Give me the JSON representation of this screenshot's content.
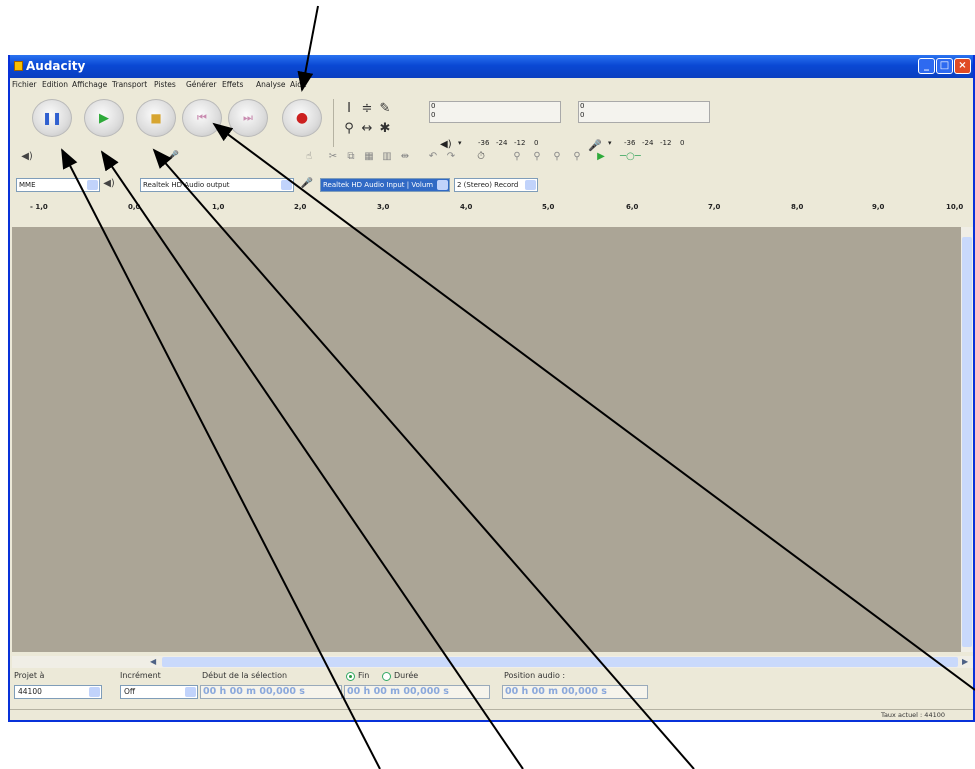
{
  "window": {
    "title": "Audacity"
  },
  "menubar": {
    "items": [
      "Fichier",
      "Edition",
      "Affichage",
      "Transport",
      "Pistes",
      "Générer",
      "Effets",
      "Analyse",
      "Aide"
    ]
  },
  "meters": {
    "play_zero": "0",
    "rec_zero": "0",
    "scale": [
      "-36",
      "-24",
      "-12",
      "0"
    ]
  },
  "devices": {
    "host": "MME",
    "output": "Realtek HD Audio output",
    "input": "Realtek HD Audio Input | Volum",
    "channels": "2 (Stereo) Record"
  },
  "ruler": {
    "ticks": [
      "- 1,0",
      "0,0",
      "1,0",
      "2,0",
      "3,0",
      "4,0",
      "5,0",
      "6,0",
      "7,0",
      "8,0",
      "9,0",
      "10,0"
    ]
  },
  "selection": {
    "rate_label": "Projet à",
    "rate_value": "44100",
    "snap_label": "Incrément",
    "snap_value": "Off",
    "start_label": "Début de la sélection",
    "end_label": "Fin",
    "length_label": "Durée",
    "audio_pos_label": "Position audio :",
    "start_time": "00 h 00 m 00,000 s",
    "end_time": "00 h 00 m 00,000 s",
    "audio_pos_time": "00 h 00 m 00,000 s"
  },
  "statusbar": {
    "text": "Taux actuel : 44100"
  },
  "colors": {
    "titlebar": "#0a48d4",
    "track_bg": "#aba596",
    "record": "#cc2020",
    "play": "#2eaa3a",
    "pause": "#3060d0"
  },
  "icons": [
    "pause-icon",
    "play-icon",
    "stop-icon",
    "skip-start-icon",
    "skip-end-icon",
    "record-icon"
  ]
}
